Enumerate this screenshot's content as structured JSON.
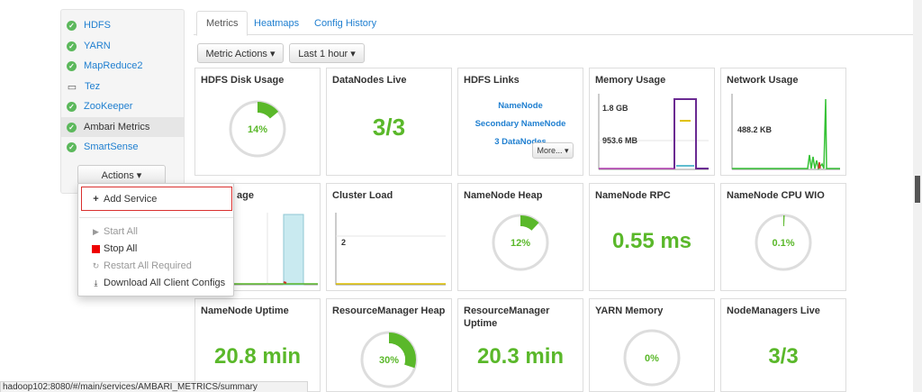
{
  "sidebar": {
    "services": [
      {
        "label": "HDFS",
        "status": "ok"
      },
      {
        "label": "YARN",
        "status": "ok"
      },
      {
        "label": "MapReduce2",
        "status": "ok"
      },
      {
        "label": "Tez",
        "status": "client"
      },
      {
        "label": "ZooKeeper",
        "status": "ok"
      },
      {
        "label": "Ambari Metrics",
        "status": "ok",
        "active": true
      },
      {
        "label": "SmartSense",
        "status": "ok"
      }
    ],
    "actions_label": "Actions ▾"
  },
  "actions_menu": {
    "add_service": "Add Service",
    "start_all": "Start All",
    "stop_all": "Stop All",
    "restart_all": "Restart All Required",
    "download_configs": "Download All Client Configs"
  },
  "tabs": [
    "Metrics",
    "Heatmaps",
    "Config History"
  ],
  "toolbar": {
    "metric_actions": "Metric Actions ▾",
    "time_range": "Last 1 hour ▾"
  },
  "widgets": {
    "hdfs_disk_usage": {
      "title": "HDFS Disk Usage",
      "value": "14%",
      "fraction": 0.14
    },
    "datanodes_live": {
      "title": "DataNodes Live",
      "value": "3/3"
    },
    "hdfs_links": {
      "title": "HDFS Links",
      "links": [
        "NameNode",
        "Secondary NameNode",
        "3 DataNodes"
      ],
      "more": "More... ▾"
    },
    "memory_usage": {
      "title": "Memory Usage",
      "tick_top": "1.8 GB",
      "tick_bottom": "953.6 MB"
    },
    "network_usage": {
      "title": "Network Usage",
      "tick": "488.2 KB"
    },
    "cpu_usage": {
      "title": "age"
    },
    "cluster_load": {
      "title": "Cluster Load",
      "tick": "2"
    },
    "namenode_heap": {
      "title": "NameNode Heap",
      "value": "12%",
      "fraction": 0.12
    },
    "namenode_rpc": {
      "title": "NameNode RPC",
      "value": "0.55 ms"
    },
    "namenode_cpu_wio": {
      "title": "NameNode CPU WIO",
      "value": "0.1%",
      "fraction": 0.001
    },
    "namenode_uptime": {
      "title": "NameNode Uptime",
      "value": "20.8 min"
    },
    "rm_heap": {
      "title": "ResourceManager Heap",
      "value": "30%",
      "fraction": 0.3
    },
    "rm_uptime": {
      "title": "ResourceManager Uptime",
      "value": "20.3 min"
    },
    "yarn_memory": {
      "title": "YARN Memory",
      "value": "0%",
      "fraction": 0
    },
    "nodemanagers_live": {
      "title": "NodeManagers Live",
      "value": "3/3"
    }
  },
  "status_url": "hadoop102:8080/#/main/services/AMBARI_METRICS/summary",
  "colors": {
    "accent_green": "#5ab82a",
    "link_blue": "#1f7fd0",
    "alert_red": "#d9302e"
  }
}
